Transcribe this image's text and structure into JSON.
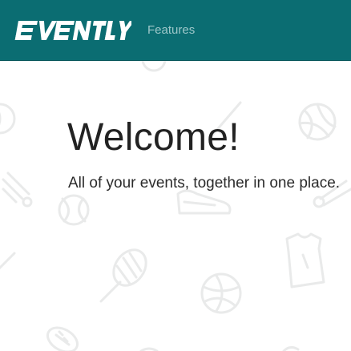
{
  "navbar": {
    "brand": "EVENTLY",
    "links": [
      {
        "label": "Features"
      }
    ]
  },
  "hero": {
    "title": "Welcome!",
    "subtitle": "All of your events, together in one place."
  },
  "background": {
    "pattern": "sports-doodles",
    "icons": [
      "tennis-ball-icon",
      "volleyball-icon",
      "sneaker-icon",
      "shuttlecock-icon",
      "tennis-racket-icon",
      "basketball-icon",
      "jersey-icon",
      "american-football-icon",
      "baseball-bat-icon"
    ]
  },
  "colors": {
    "navbar_bg": "#0b6d72",
    "brand": "#ffffff",
    "nav_link": "#9fc8ca",
    "text": "#222222"
  }
}
